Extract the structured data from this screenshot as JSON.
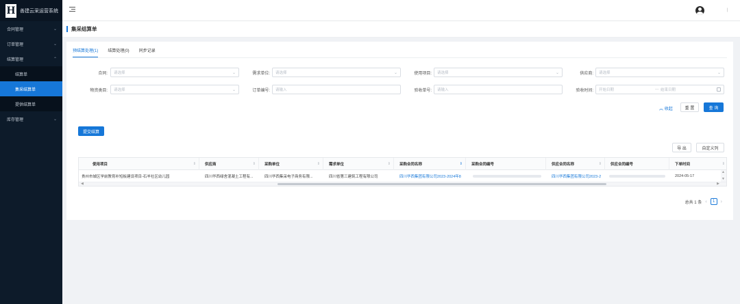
{
  "app": {
    "title": "善建云采运营系统"
  },
  "sidebar": {
    "items": [
      {
        "label": "合同管理"
      },
      {
        "label": "订单管理"
      },
      {
        "label": "结算管理",
        "expanded": true,
        "children": [
          {
            "label": "结算单"
          },
          {
            "label": "集采结算单",
            "active": true
          },
          {
            "label": "提供结算单"
          }
        ]
      },
      {
        "label": "库存管理"
      }
    ]
  },
  "page": {
    "title": "集采结算单"
  },
  "tabs": [
    {
      "label": "预结算处理(1)",
      "active": true
    },
    {
      "label": "结算处理(0)"
    },
    {
      "label": "同步记录"
    }
  ],
  "filters": {
    "contract": {
      "label": "合同:",
      "placeholder": "请选择"
    },
    "demand_unit": {
      "label": "需求单位:",
      "placeholder": "请选择"
    },
    "project": {
      "label": "使用项目:",
      "placeholder": "请选择"
    },
    "supplier": {
      "label": "供应商:",
      "placeholder": "请选择"
    },
    "material_category": {
      "label": "物资类目:",
      "placeholder": "请选择"
    },
    "order_no": {
      "label": "订单编号:",
      "placeholder": "请输入"
    },
    "receipt_no": {
      "label": "验收单号:",
      "placeholder": "请输入"
    },
    "receipt_time": {
      "label": "验收时间:",
      "start_placeholder": "开始日期",
      "separator": "—",
      "end_placeholder": "结束日期"
    }
  },
  "actions": {
    "collapse": "收起",
    "reset": "重 置",
    "search": "查 询",
    "submit": "提交结算",
    "export": "导 出",
    "custom_columns": "自定义列"
  },
  "table": {
    "columns": [
      "使用项目",
      "供应商",
      "采购单位",
      "需求单位",
      "采购合同名称",
      "采购合同编号",
      "供应合同名称",
      "供应合同编号",
      "下单时间"
    ],
    "rows": [
      [
        "贵州市城区学前教育补短板建设项目-石羊社区幼儿园",
        "四川华西绿舍混凝土工程有...",
        "四川华西集采电子商务有限...",
        "四川省第三建筑工程有限公司",
        "四川华西集团有限公司2023-2024年8",
        "",
        "四川华西集团有限公司2023-2",
        "",
        "2024-05-17"
      ]
    ]
  },
  "pagination": {
    "total_text": "总共 1 条",
    "current_page": "1"
  }
}
